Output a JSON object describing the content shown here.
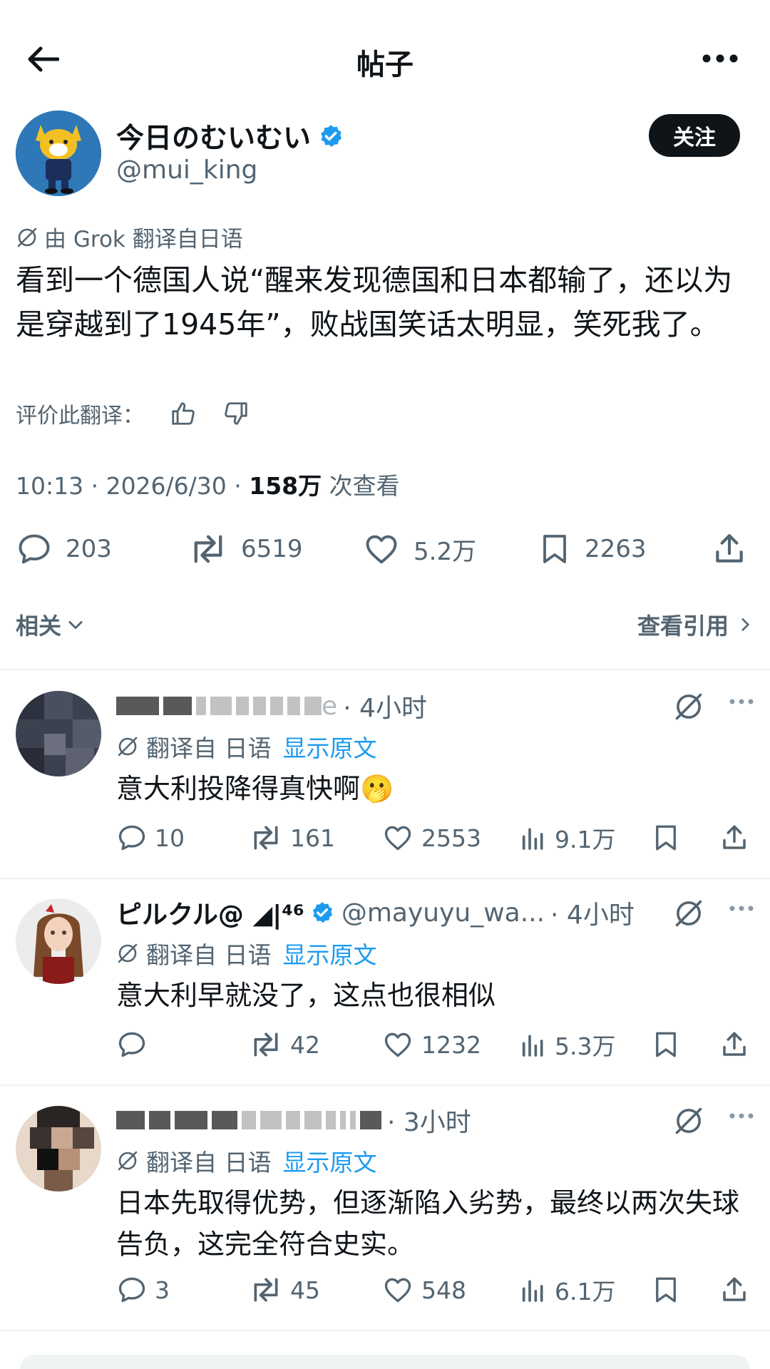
{
  "header": {
    "title": "帖子"
  },
  "post": {
    "author_name": "今日のむいむい",
    "author_handle": "@mui_king",
    "follow_label": "关注",
    "translated_note": "由 Grok 翻译自日语",
    "text": "看到一个德国人说“醒来发现德国和日本都输了，还以为是穿越到了1945年”，败战国笑话太明显，笑死我了。",
    "rate_label": "评价此翻译：",
    "time_date": "10:13 · 2026/6/30 · ",
    "views_count": "158万",
    "views_label": " 次查看",
    "stats": {
      "replies": "203",
      "reposts": "6519",
      "likes": "5.2万",
      "bookmarks": "2263"
    },
    "related_label": "相关",
    "quotes_label": "查看引用"
  },
  "replies": [
    {
      "name": "",
      "handle_suffix": "e",
      "time": "· 4小时",
      "translated_from": "翻译自 日语",
      "show_original": "显示原文",
      "text": "意大利投降得真快啊🫢",
      "stats": {
        "replies": "10",
        "reposts": "161",
        "likes": "2553",
        "views": "9.1万"
      }
    },
    {
      "name": "ピルクル@ ◢|⁴⁶",
      "handle": "@mayuyu_wa...",
      "time": "· 4小时",
      "translated_from": "翻译自 日语",
      "show_original": "显示原文",
      "text": "意大利早就没了，这点也很相似",
      "stats": {
        "replies": "",
        "reposts": "42",
        "likes": "1232",
        "views": "5.3万"
      }
    },
    {
      "name": "",
      "time": "· 3小时",
      "translated_from": "翻译自 日语",
      "show_original": "显示原文",
      "text": "日本先取得优势，但逐渐陷入劣势，最终以两次失球告负，这完全符合史实。",
      "stats": {
        "replies": "3",
        "reposts": "45",
        "likes": "548",
        "views": "6.1万"
      }
    }
  ],
  "colors": {
    "accent": "#1d9bf0",
    "text": "#0f1419",
    "secondary": "#536471",
    "divider": "#eff3f4"
  }
}
